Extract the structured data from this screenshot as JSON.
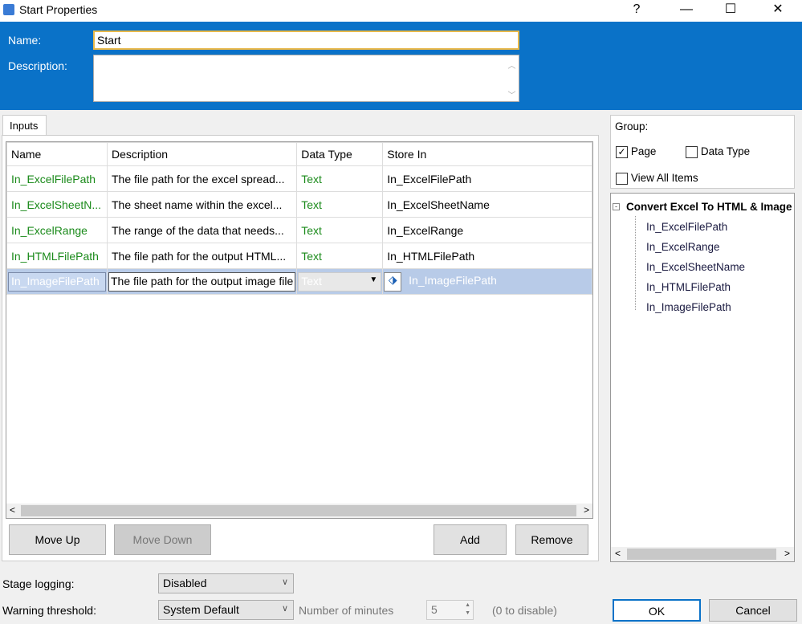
{
  "window": {
    "title": "Start Properties",
    "help": "?",
    "minimize": "—",
    "maximize": "☐",
    "close": "✕"
  },
  "header": {
    "name_label": "Name:",
    "name_value": "Start",
    "description_label": "Description:",
    "description_value": ""
  },
  "tabs": [
    {
      "label": "Inputs"
    }
  ],
  "table": {
    "columns": [
      "Name",
      "Description",
      "Data Type",
      "Store In"
    ],
    "rows": [
      {
        "name": "In_ExcelFilePath",
        "description": "The file path for the excel spread...",
        "type": "Text",
        "store": "In_ExcelFilePath"
      },
      {
        "name": "In_ExcelSheetN...",
        "description": "The sheet name within the excel...",
        "type": "Text",
        "store": "In_ExcelSheetName"
      },
      {
        "name": "In_ExcelRange",
        "description": "The range of the data that needs...",
        "type": "Text",
        "store": "In_ExcelRange"
      },
      {
        "name": "In_HTMLFilePath",
        "description": "The file path for the output HTML...",
        "type": "Text",
        "store": "In_HTMLFilePath"
      },
      {
        "name": "In_ImageFilePath",
        "description": "The file path for the output image file",
        "type": "Text",
        "store": "In_ImageFilePath"
      }
    ]
  },
  "buttons": {
    "move_up": "Move Up",
    "move_down": "Move Down",
    "add": "Add",
    "remove": "Remove",
    "ok": "OK",
    "cancel": "Cancel"
  },
  "group": {
    "label": "Group:",
    "page": "Page",
    "page_checked": true,
    "data_type": "Data Type",
    "data_type_checked": false,
    "view_all": "View All Items",
    "view_all_checked": false
  },
  "tree": {
    "root": "Convert Excel To HTML & Image",
    "items": [
      "In_ExcelFilePath",
      "In_ExcelRange",
      "In_ExcelSheetName",
      "In_HTMLFilePath",
      "In_ImageFilePath"
    ]
  },
  "settings": {
    "stage_logging_label": "Stage logging:",
    "stage_logging_value": "Disabled",
    "warning_label": "Warning threshold:",
    "warning_value": "System Default",
    "minutes_label": "Number of minutes",
    "minutes_value": "5",
    "disable_hint": "(0 to disable)"
  }
}
